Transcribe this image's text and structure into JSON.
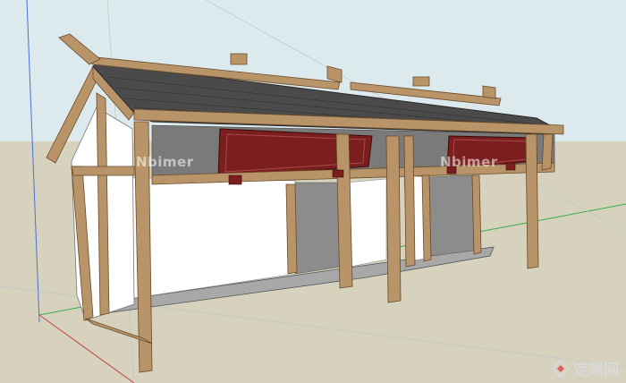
{
  "scene": {
    "colors": {
      "sky": "#dce9ed",
      "ground": "#d6d2bd",
      "wood_light": "#b89468",
      "wood_dark": "#7a5a36",
      "roof_tile": "#4a4a4a",
      "signboard": "#7a1e1e",
      "wall_white": "#ffffff",
      "interior_gray": "#8c8c8c",
      "axis_blue": "#4a6fd8",
      "axis_green": "#35b04a",
      "axis_red": "#c84040"
    }
  },
  "watermarks": {
    "left": "Nbimer",
    "right": "Nbimer"
  },
  "brand": {
    "text": "定鼎网",
    "logo_icon": "dingding-logo-icon"
  }
}
